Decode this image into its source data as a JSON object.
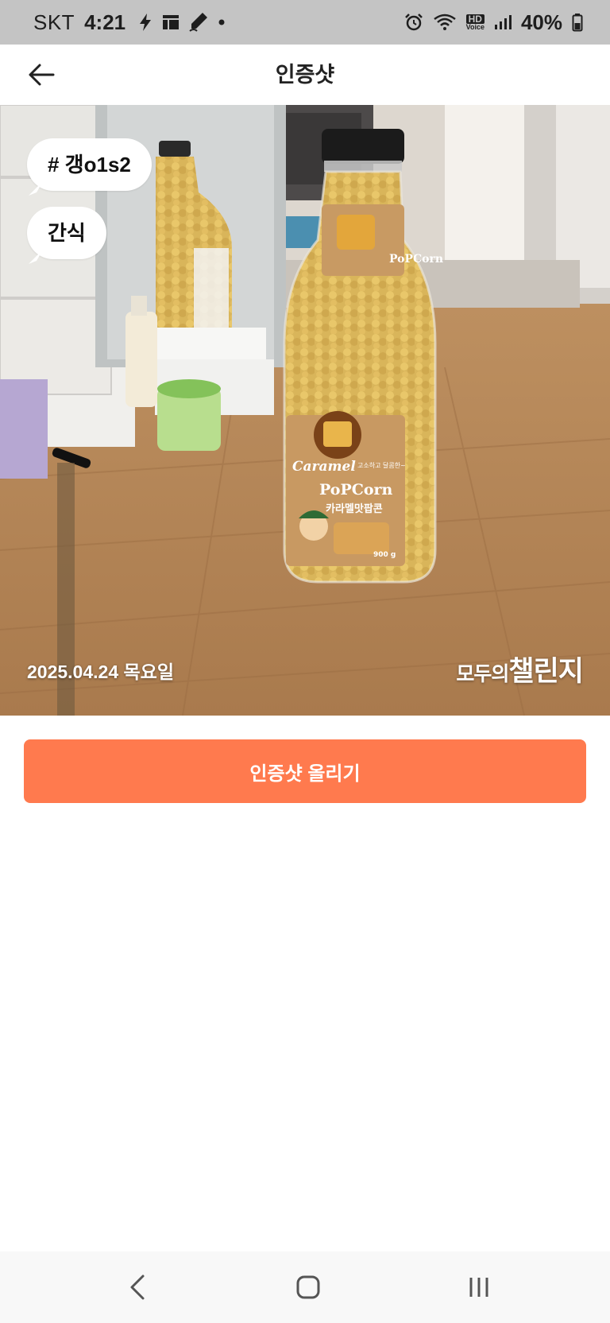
{
  "status_bar": {
    "carrier": "SKT",
    "time": "4:21",
    "battery_percent": "40%",
    "left_icons": [
      "bolt-icon",
      "grid-icon",
      "pen-icon",
      "dot-icon"
    ],
    "right_icons": [
      "alarm-icon",
      "wifi-icon",
      "hd-voice-icon",
      "signal-icon",
      "battery-icon"
    ],
    "hd_voice_top": "HD",
    "hd_voice_bottom": "Voice"
  },
  "header": {
    "title": "인증샷",
    "back_icon": "arrow-left-icon"
  },
  "photo": {
    "hashtag": "# 갱o1s2",
    "category": "간식",
    "date": "2025.04.24 목요일",
    "watermark_small": "모두의",
    "watermark_big": "챌린지",
    "label_brand": "Caramel",
    "label_product": "PoPCorn",
    "label_korean": "카라멜맛팝콘",
    "label_tagline": "고소하고 달콤한~",
    "label_weight": "900 g",
    "neck_label": "PoPCorn"
  },
  "actions": {
    "upload_label": "인증샷 올리기"
  },
  "nav_bar": {
    "buttons": [
      "back-icon",
      "home-icon",
      "recent-apps-icon"
    ]
  },
  "colors": {
    "accent": "#ff7a4e",
    "status_bar_bg": "#c4c4c4",
    "nav_bar_bg": "#f8f8f8"
  }
}
